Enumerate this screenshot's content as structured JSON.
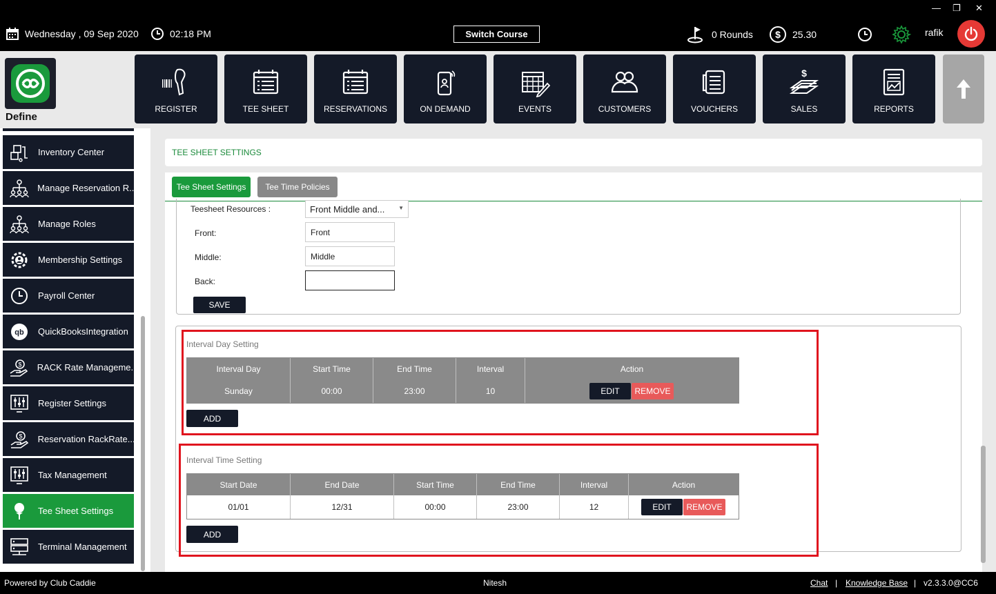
{
  "window": {
    "minimize": "—",
    "restore": "❐",
    "close": "✕"
  },
  "topbar": {
    "date": "Wednesday ,  09 Sep 2020",
    "time": "02:18 PM",
    "switch_course": "Switch Course",
    "rounds": "0 Rounds",
    "balance": "25.30",
    "username": "rafik"
  },
  "brand": {
    "label": "Define"
  },
  "modules": [
    {
      "label": "REGISTER",
      "icon": "barcode-scanner-icon"
    },
    {
      "label": "TEE SHEET",
      "icon": "tee-sheet-icon"
    },
    {
      "label": "RESERVATIONS",
      "icon": "reservations-icon"
    },
    {
      "label": "ON DEMAND",
      "icon": "mobile-icon"
    },
    {
      "label": "EVENTS",
      "icon": "calendar-edit-icon"
    },
    {
      "label": "CUSTOMERS",
      "icon": "customers-icon"
    },
    {
      "label": "VOUCHERS",
      "icon": "voucher-icon"
    },
    {
      "label": "SALES",
      "icon": "sales-icon"
    },
    {
      "label": "REPORTS",
      "icon": "reports-icon"
    }
  ],
  "sidebar": {
    "items": [
      {
        "label": "Inventory Center",
        "icon": "inventory-icon"
      },
      {
        "label": "Manage Reservation R...",
        "icon": "org-chart-icon"
      },
      {
        "label": "Manage Roles",
        "icon": "org-chart-icon"
      },
      {
        "label": "Membership Settings",
        "icon": "gear-icon"
      },
      {
        "label": "Payroll Center",
        "icon": "clock-icon"
      },
      {
        "label": "QuickBooksIntegration",
        "icon": "quickbooks-icon"
      },
      {
        "label": "RACK Rate Manageme...",
        "icon": "money-hand-icon"
      },
      {
        "label": "Register Settings",
        "icon": "sliders-icon"
      },
      {
        "label": "Reservation RackRate...",
        "icon": "money-hand-icon"
      },
      {
        "label": "Tax Management",
        "icon": "sliders-icon"
      },
      {
        "label": "Tee Sheet Settings",
        "icon": "golf-tee-icon",
        "active": true
      },
      {
        "label": "Terminal Management",
        "icon": "server-icon"
      }
    ]
  },
  "page": {
    "title": "TEE SHEET SETTINGS",
    "tabs": [
      "Tee Sheet Settings",
      "Tee Time Policies"
    ]
  },
  "resources": {
    "label": "Teesheet Resources :",
    "selected": "Front Middle and...",
    "front_label": "Front:",
    "front_value": "Front",
    "middle_label": "Middle:",
    "middle_value": "Middle",
    "back_label": "Back:",
    "back_value": "",
    "save": "SAVE"
  },
  "interval_day": {
    "title": "Interval Day Setting",
    "columns": [
      "Interval Day",
      "Start Time",
      "End Time",
      "Interval",
      "Action"
    ],
    "rows": [
      [
        "Sunday",
        "00:00",
        "23:00",
        "10"
      ]
    ],
    "edit": "EDIT",
    "remove": "REMOVE",
    "add": "ADD"
  },
  "interval_time": {
    "title": "Interval Time Setting",
    "columns": [
      "Start Date",
      "End Date",
      "Start Time",
      "End Time",
      "Interval",
      "Action"
    ],
    "rows": [
      [
        "01/01",
        "12/31",
        "00:00",
        "23:00",
        "12"
      ]
    ],
    "edit": "EDIT",
    "remove": "REMOVE",
    "add": "ADD"
  },
  "footer": {
    "powered": "Powered by Club Caddie",
    "user": "Nitesh",
    "chat": "Chat",
    "sep": "|",
    "kb": "Knowledge Base",
    "version": "v2.3.3.0@CC6"
  },
  "colors": {
    "accent_green": "#1a9a3c",
    "dark": "#141a28",
    "danger": "#e53935",
    "highlight": "#e0141e"
  }
}
